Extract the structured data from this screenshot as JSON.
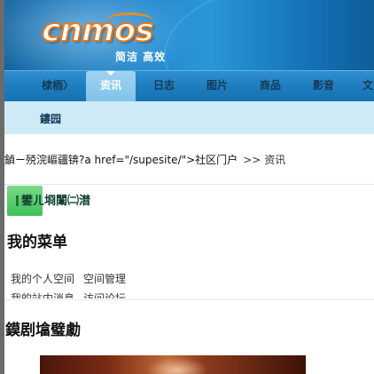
{
  "logo": {
    "text": "cnmos",
    "slogan": "简洁 高效"
  },
  "nav": {
    "items": [
      {
        "label": "棣栭〉",
        "active": false
      },
      {
        "label": "资讯",
        "active": true
      },
      {
        "label": "日志",
        "active": false
      },
      {
        "label": "图片",
        "active": false
      },
      {
        "label": "商品",
        "active": false
      },
      {
        "label": "影音",
        "active": false
      },
      {
        "label": "文",
        "active": false
      }
    ]
  },
  "subnav": {
    "label": "鏤园"
  },
  "breadcrumb": {
    "prefix": "鍞ㄧ殑浣嶇疆锛?a href=\"/supesite/\">社区门户",
    "sep": ">>",
    "current": "资讯"
  },
  "userbox": {
    "title": "鐢ㄦ埛闈㈡澘"
  },
  "menu": {
    "title": "我的菜单",
    "links": [
      "我的个人空间",
      "空间管理",
      "我的站内消息",
      "访问论坛"
    ]
  },
  "section": {
    "title": "鏌剧墖璧勮"
  },
  "colors": {
    "header_blue": "#1b7ec4",
    "nav_blue": "#1e7dbf",
    "subnav_bg": "#cfeaf7",
    "logo_orange": "#e67a1a",
    "userbox_green": "#3fbf59"
  }
}
